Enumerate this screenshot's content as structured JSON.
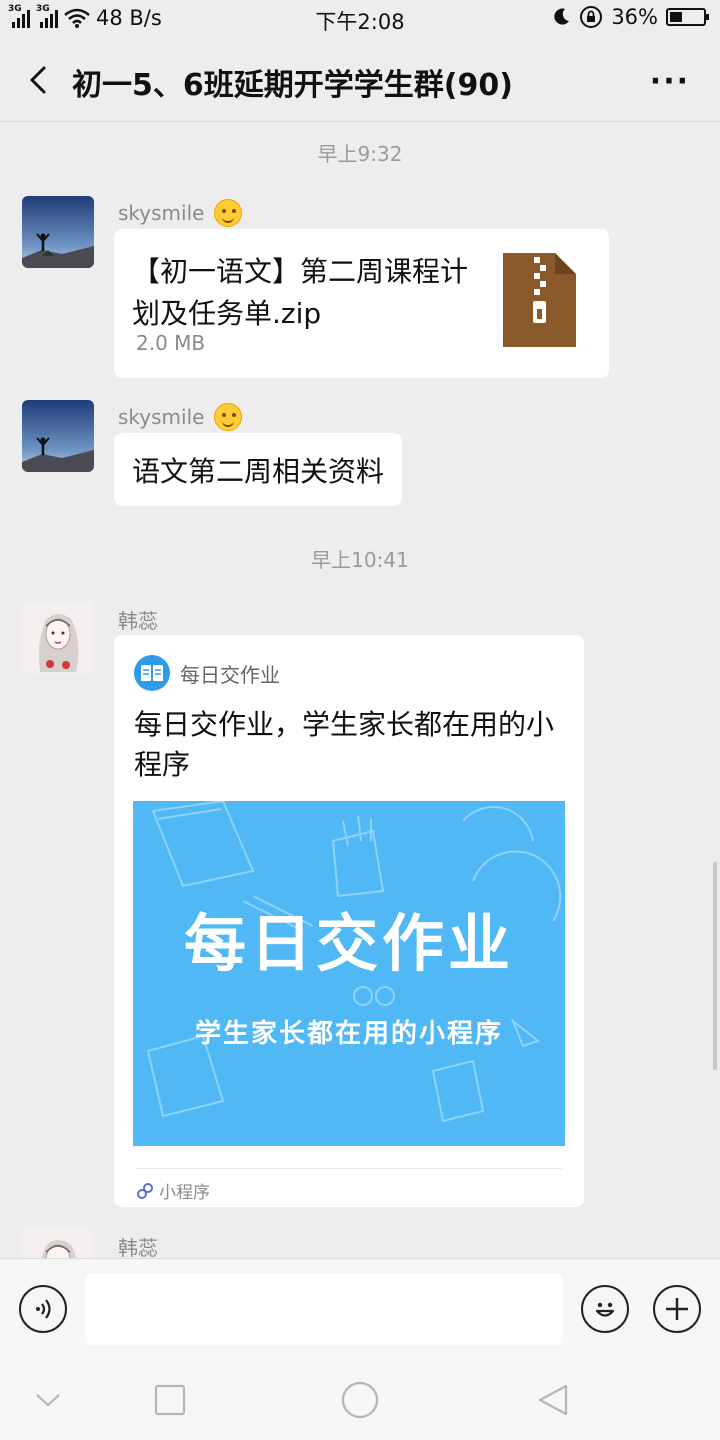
{
  "status_bar": {
    "network_tag_1": "3G",
    "network_tag_2": "3G",
    "speed": "48 B/s",
    "time": "下午2:08",
    "battery_percent": "36%",
    "battery_level": 0.36
  },
  "header": {
    "title": "初一5、6班延期开学学生群(90)",
    "more": "···"
  },
  "messages": {
    "time1": "早上9:32",
    "msg1": {
      "sender": "skysmile",
      "file_name": "【初一语文】第二周课程计划及任务单.zip",
      "file_size": "2.0 MB",
      "file_icon": "zip-file-icon"
    },
    "msg2": {
      "sender": "skysmile",
      "text": "语文第二周相关资料"
    },
    "time2": "早上10:41",
    "msg3": {
      "sender": "韩蕊",
      "app_name": "每日交作业",
      "title": "每日交作业，学生家长都在用的小程序",
      "cover_title": "每日交作业",
      "cover_subtitle": "学生家长都在用的小程序",
      "footer": "小程序"
    },
    "msg4": {
      "sender": "韩蕊"
    }
  },
  "input_bar": {
    "voice_icon": "voice-icon",
    "emoji_icon": "emoji-icon",
    "plus_icon": "plus-icon",
    "value": ""
  },
  "navbar": {
    "icons": [
      "chevron-down-icon",
      "square-icon",
      "circle-icon",
      "back-triangle-icon"
    ]
  },
  "colors": {
    "background": "#ededed",
    "bubble": "#ffffff",
    "cover": "#4fb8f5",
    "zip": "#8b5a2b"
  }
}
